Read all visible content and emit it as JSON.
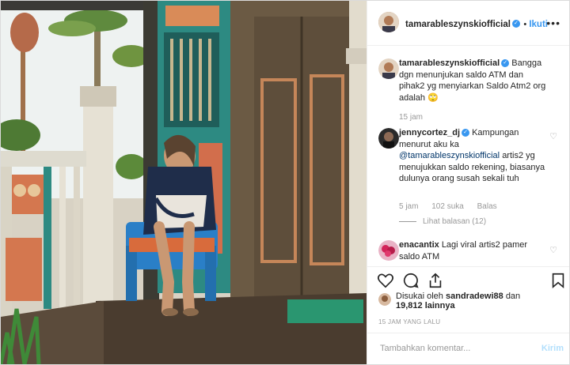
{
  "post": {
    "username": "tamarableszynskiofficial",
    "follow_label": "Ikuti",
    "more_label": "•••"
  },
  "comments": [
    {
      "username": "tamarableszynskiofficial",
      "text": "Bangga dgn menunjukan saldo ATM dan pihak2 yg menyiarkan Saldo Atm2 org adalah 🙄",
      "time": "15 jam"
    },
    {
      "username": "jennycortez_dj",
      "text_before": "Kampungan menurut aku ka",
      "mention": "@tamarableszynskiofficial",
      "text_after": "artis2 yg menujukkan saldo rekening, biasanya dulunya orang susah sekali tuh",
      "time": "5 jam",
      "likes": "102 suka",
      "reply": "Balas",
      "view_replies": "Lihat balasan (12)"
    },
    {
      "username": "enacantix",
      "text": "Lagi viral artis2 pamer saldo ATM"
    }
  ],
  "likes": {
    "prefix": "Disukai oleh",
    "user": "sandradewi88",
    "connector": "dan",
    "others": "19,812 lainnya"
  },
  "date_label": "15 JAM YANG LALU",
  "comment_box": {
    "placeholder": "Tambahkan komentar...",
    "post_label": "Kirim"
  },
  "colors": {
    "link": "#3897f0",
    "muted": "#999999",
    "text": "#262626"
  }
}
